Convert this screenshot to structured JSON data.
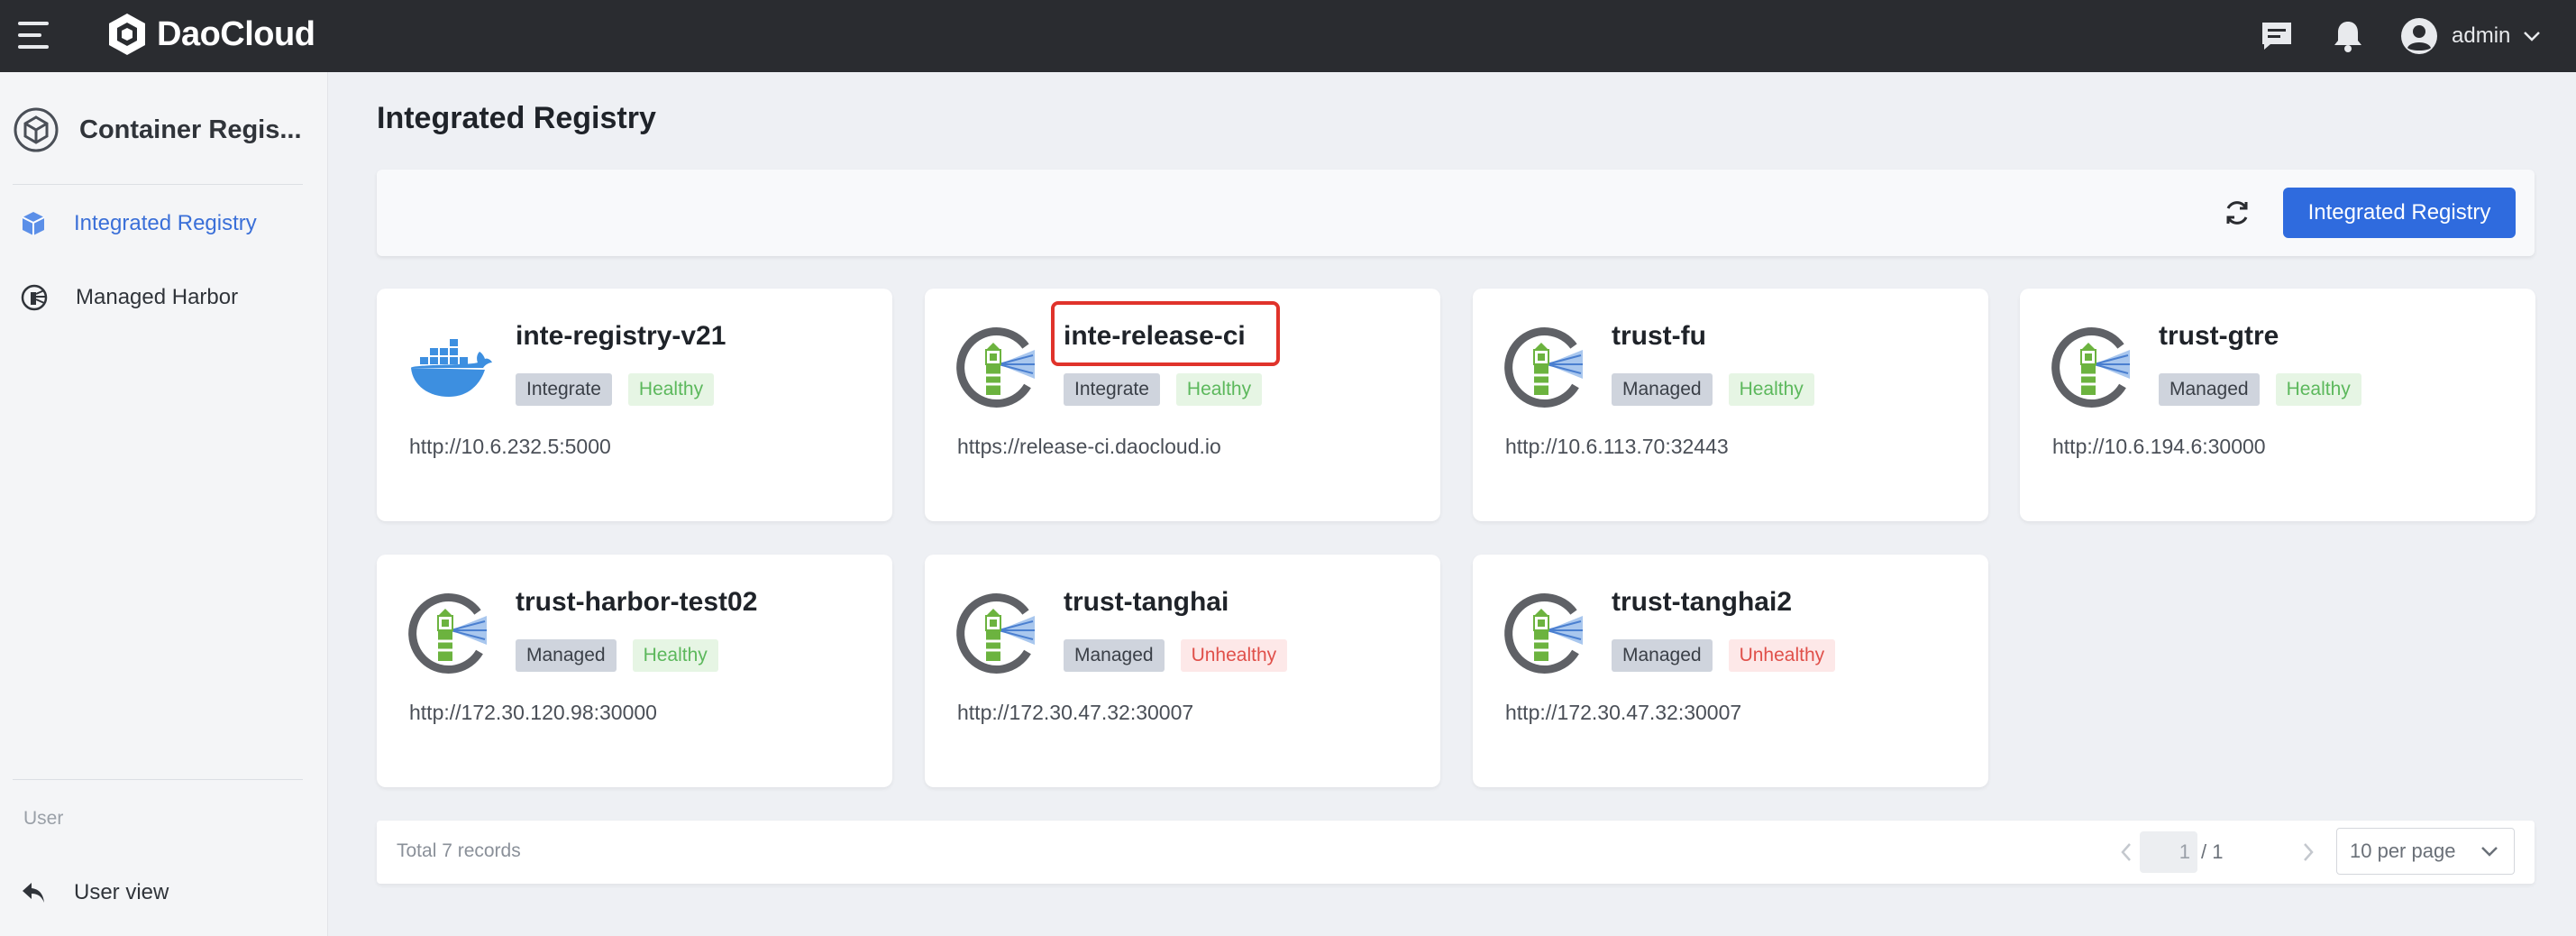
{
  "topbar": {
    "brand": "DaoCloud",
    "user_name": "admin",
    "icons": [
      "menu-icon",
      "daocloud-logo-icon",
      "message-icon",
      "bell-icon",
      "user-avatar-icon",
      "chevron-down-icon"
    ]
  },
  "sidebar": {
    "module_title": "Container Regis...",
    "items": [
      {
        "label": "Integrated Registry",
        "icon": "cube-icon",
        "active": true
      },
      {
        "label": "Managed Harbor",
        "icon": "harbor-icon",
        "active": false
      }
    ],
    "section_label": "User",
    "user_view_label": "User view",
    "user_view_icon": "back-arrow-icon"
  },
  "main": {
    "title": "Integrated Registry",
    "primary_button": "Integrated Registry",
    "refresh_icon": "refresh-icon"
  },
  "cards": [
    {
      "name": "inte-registry-v21",
      "type": "Integrate",
      "status": "Healthy",
      "url": "http://10.6.232.5:5000",
      "icon": "docker-icon"
    },
    {
      "name": "inte-release-ci",
      "type": "Integrate",
      "status": "Healthy",
      "url": "https://release-ci.daocloud.io",
      "icon": "harbor-icon"
    },
    {
      "name": "trust-fu",
      "type": "Managed",
      "status": "Healthy",
      "url": "http://10.6.113.70:32443",
      "icon": "harbor-icon"
    },
    {
      "name": "trust-gtre",
      "type": "Managed",
      "status": "Healthy",
      "url": "http://10.6.194.6:30000",
      "icon": "harbor-icon"
    },
    {
      "name": "trust-harbor-test02",
      "type": "Managed",
      "status": "Healthy",
      "url": "http://172.30.120.98:30000",
      "icon": "harbor-icon"
    },
    {
      "name": "trust-tanghai",
      "type": "Managed",
      "status": "Unhealthy",
      "url": "http://172.30.47.32:30007",
      "icon": "harbor-icon"
    },
    {
      "name": "trust-tanghai2",
      "type": "Managed",
      "status": "Unhealthy",
      "url": "http://172.30.47.32:30007",
      "icon": "harbor-icon"
    }
  ],
  "pagination": {
    "total_text": "Total 7 records",
    "current_page": "1",
    "page_total": "/ 1",
    "page_size": "10 per page"
  },
  "colors": {
    "accent": "#2f6bde",
    "topbar": "#2a2c30",
    "healthy": "#5cb85c",
    "unhealthy": "#e0504a",
    "highlight": "#e0332b"
  }
}
